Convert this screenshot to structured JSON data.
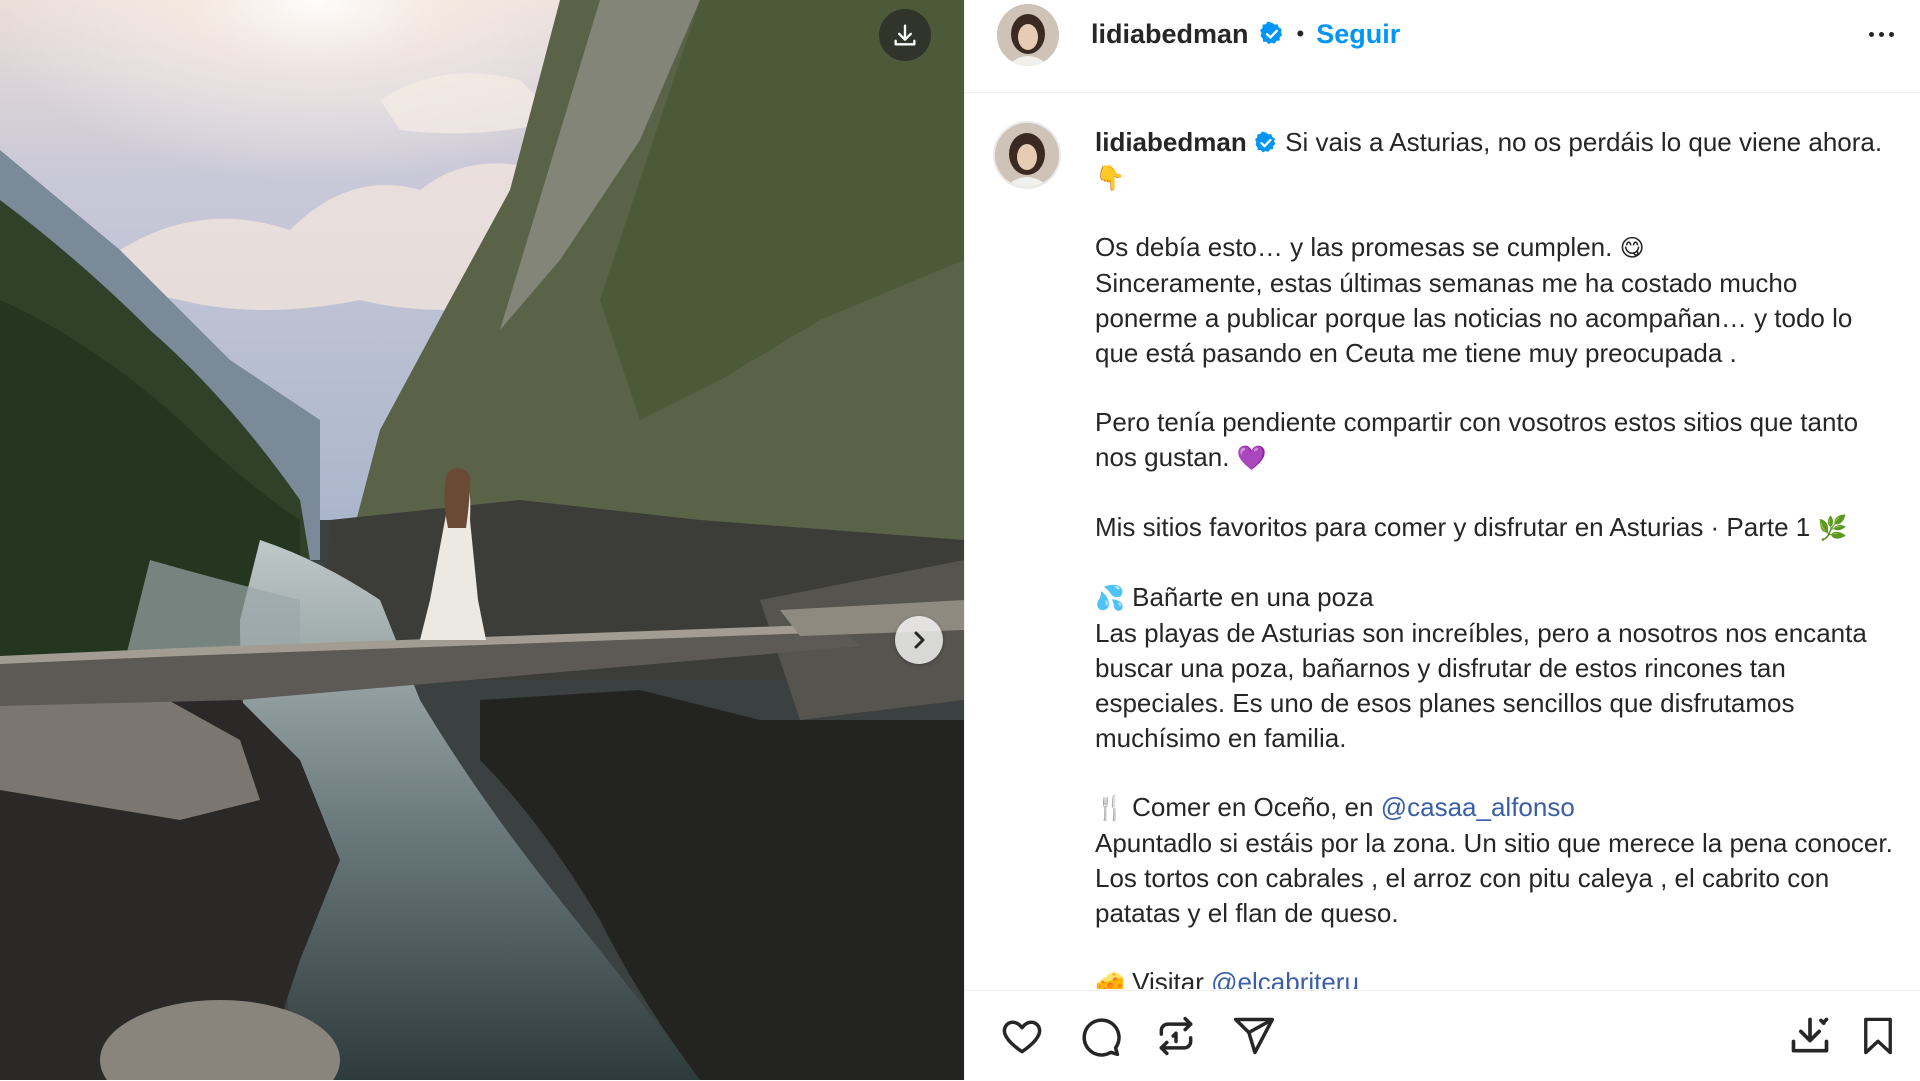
{
  "header": {
    "username": "lidiabedman",
    "separator": "•",
    "follow_label": "Seguir"
  },
  "caption": {
    "username": "lidiabedman",
    "line1": "Si vais a Asturias, no os perdáis lo que viene ahora.",
    "line1_emoji": "👇",
    "line2": "Os debía esto… y las promesas se cumplen.",
    "line2_emoji": "😋",
    "line3": "Sinceramente, estas últimas semanas me ha costado mucho ponerme a publicar porque las noticias no acompañan… y todo lo que está pasando en Ceuta me tiene muy preocupada .",
    "line4": "Pero tenía pendiente compartir con vosotros estos sitios que tanto nos gustan.",
    "line4_emoji": "💜",
    "line5": "Mis sitios favoritos para comer y disfrutar en Asturias · Parte 1",
    "line5_emoji": "🌿",
    "section1_emoji": "💦",
    "section1_title": "Bañarte en una poza",
    "section1_body": "Las playas de Asturias son increíbles, pero a nosotros nos encanta buscar una poza, bañarnos y disfrutar de estos rincones tan especiales. Es uno de esos planes sencillos que disfrutamos muchísimo en familia.",
    "section2_emoji": "🍴",
    "section2_title": "Comer en Oceño, en",
    "section2_mention": "@casaa_alfonso",
    "section2_body": "Apuntadlo si estáis por la zona. Un sitio que merece la pena conocer. Los tortos con cabrales , el arroz con pitu caleya , el cabrito con patatas y el flan de queso.",
    "section3_emoji": "🧀",
    "section3_title": "Visitar",
    "section3_mention": "@elcabriteru"
  },
  "icons": {
    "download": "download-icon",
    "next": "chevron-right-icon",
    "verified": "verified-badge-icon",
    "more": "more-options-icon",
    "like": "heart-icon",
    "comment": "comment-icon",
    "repost": "repost-icon",
    "share": "send-icon",
    "save_download": "download-icon",
    "bookmark": "bookmark-icon"
  },
  "colors": {
    "link": "#0095f6",
    "mention": "#3a5fa8",
    "text": "#262626",
    "verified": "#0095f6"
  }
}
